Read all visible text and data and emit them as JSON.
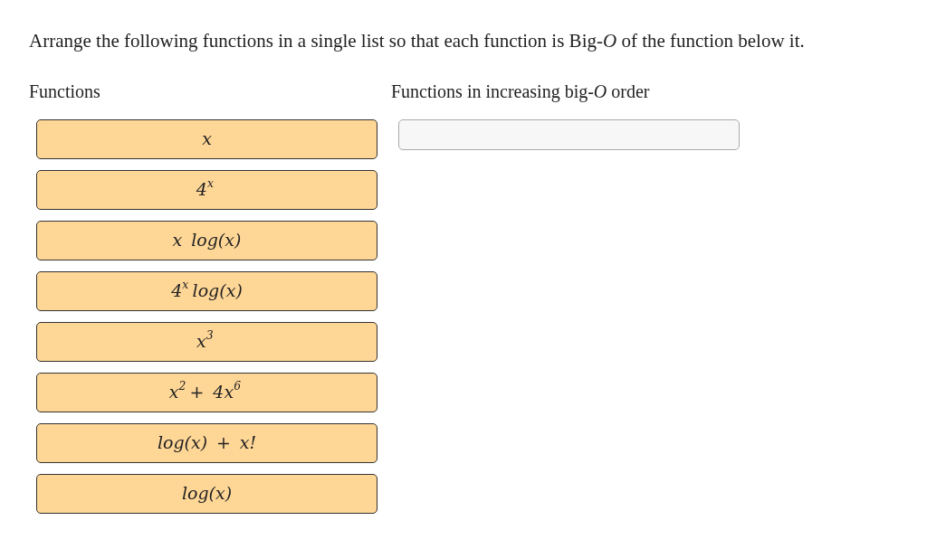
{
  "question": "Arrange the following functions in a single list so that each function is Big-*O* of the function below it.",
  "source": {
    "heading": "Functions",
    "items": [
      {
        "label": "x"
      },
      {
        "label": "4$^{x}$"
      },
      {
        "label": "x log(x)"
      },
      {
        "label": "4$^{x}$ log(x)"
      },
      {
        "label": "x$^{3}$"
      },
      {
        "label": "x$^{2}$ + 4x$^{6}$"
      },
      {
        "label": "log(x) + x!"
      },
      {
        "label": "log(x)"
      }
    ]
  },
  "target": {
    "heading": "Functions in increasing big-*O* order"
  }
}
